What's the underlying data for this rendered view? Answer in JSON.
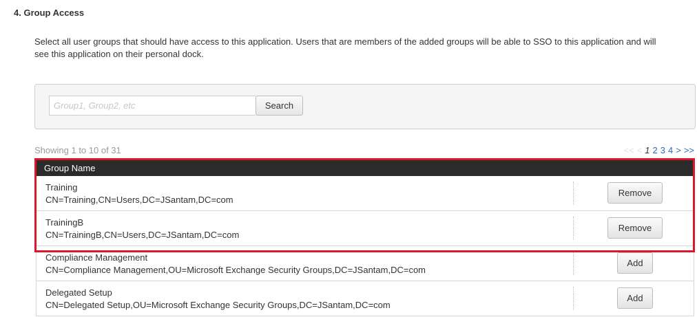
{
  "section": {
    "title": "4. Group Access",
    "description_line1": "Select all user groups that should have access to this application. Users that are members of the added groups will be able to SSO to this application and will",
    "description_line2": "see this application on their personal dock."
  },
  "search": {
    "placeholder": "Group1, Group2, etc",
    "button_label": "Search"
  },
  "results": {
    "showing": "Showing 1 to 10 of 31",
    "pagination": [
      "<<",
      "<",
      "1",
      "2",
      "3",
      "4",
      ">",
      ">>"
    ],
    "current_page": "1"
  },
  "table": {
    "header": "Group Name",
    "rows": [
      {
        "name": "Training",
        "dn": "CN=Training,CN=Users,DC=JSantam,DC=com",
        "action": "Remove"
      },
      {
        "name": "TrainingB",
        "dn": "CN=TrainingB,CN=Users,DC=JSantam,DC=com",
        "action": "Remove"
      },
      {
        "name": "Compliance Management",
        "dn": "CN=Compliance Management,OU=Microsoft Exchange Security Groups,DC=JSantam,DC=com",
        "action": "Add"
      },
      {
        "name": "Delegated Setup",
        "dn": "CN=Delegated Setup,OU=Microsoft Exchange Security Groups,DC=JSantam,DC=com",
        "action": "Add"
      }
    ]
  },
  "colors": {
    "highlight": "#d9182a",
    "header_bg": "#2b2b2b",
    "link": "#2a6ab8"
  }
}
